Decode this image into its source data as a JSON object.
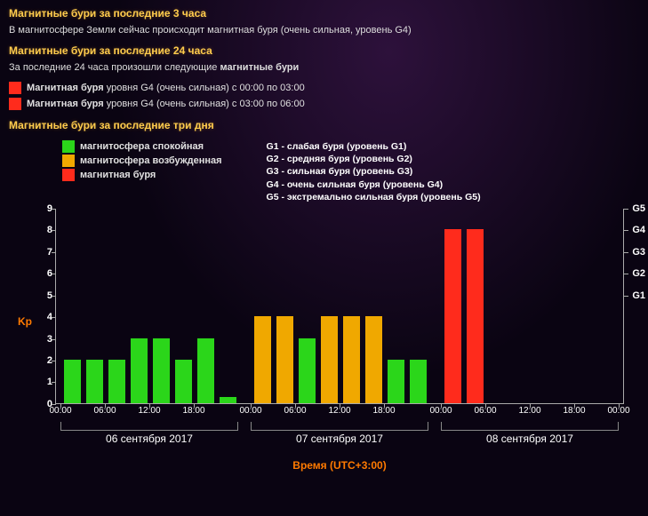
{
  "titles": {
    "three_hours": "Магнитные бури за последние 3 часа",
    "twenty_four_hours": "Магнитные бури за последние 24 часа",
    "three_days": "Магнитные бури за последние три дня"
  },
  "descriptions": {
    "three_hours": "В магнитосфере Земли сейчас происходит магнитная буря (очень сильная, уровень G4)",
    "twenty_four_prefix": "За последние 24 часа произошли следующие ",
    "twenty_four_bold": "магнитные бури"
  },
  "storm_list": [
    {
      "color": "red",
      "bold": "Магнитная буря",
      "tail": " уровня G4 (очень сильная) с 00:00 по 03:00"
    },
    {
      "color": "red",
      "bold": "Магнитная буря",
      "tail": " уровня G4 (очень сильная) с 03:00 по 06:00"
    }
  ],
  "legend": {
    "states": [
      {
        "color": "green",
        "label": "магнитосфера спокойная"
      },
      {
        "color": "orange",
        "label": "магнитосфера возбужденная"
      },
      {
        "color": "red",
        "label": "магнитная буря"
      }
    ],
    "g_levels": [
      "G1 - слабая буря (уровень G1)",
      "G2 - средняя буря (уровень G2)",
      "G3 - сильная буря (уровень G3)",
      "G4 - очень сильная буря (уровень G4)",
      "G5 - экстремально сильная буря (уровень G5)"
    ]
  },
  "chart_data": {
    "type": "bar",
    "title": "",
    "ylabel": "Kp",
    "xlabel": "Время (UTC+3:00)",
    "ylim": [
      0,
      9
    ],
    "y_ticks": [
      0,
      1,
      2,
      3,
      4,
      5,
      6,
      7,
      8,
      9
    ],
    "right_ticks": [
      {
        "label": "G1",
        "at": 5
      },
      {
        "label": "G2",
        "at": 6
      },
      {
        "label": "G3",
        "at": 7
      },
      {
        "label": "G4",
        "at": 8
      },
      {
        "label": "G5",
        "at": 9
      }
    ],
    "x_tick_labels": [
      "00:00",
      "06:00",
      "12:00",
      "18:00",
      "00:00",
      "06:00",
      "12:00",
      "18:00",
      "00:00",
      "06:00",
      "12:00",
      "18:00",
      "00:00"
    ],
    "days": [
      "06 сентября 2017",
      "07 сентября 2017",
      "08 сентября 2017"
    ],
    "values": [
      2,
      2,
      2,
      3,
      3,
      2,
      3,
      0.3,
      4,
      4,
      3,
      4,
      4,
      4,
      2,
      2,
      8,
      8
    ],
    "colors": [
      "green",
      "green",
      "green",
      "green",
      "green",
      "green",
      "green",
      "green",
      "orange",
      "orange",
      "green",
      "orange",
      "orange",
      "orange",
      "green",
      "green",
      "red",
      "red"
    ],
    "colors_meaning": {
      "green": "#2bd61a",
      "orange": "#f0a800",
      "red": "#ff2b1c"
    },
    "time_slots_per_day": 8,
    "days_count": 3,
    "timezone": "UTC+3:00"
  }
}
